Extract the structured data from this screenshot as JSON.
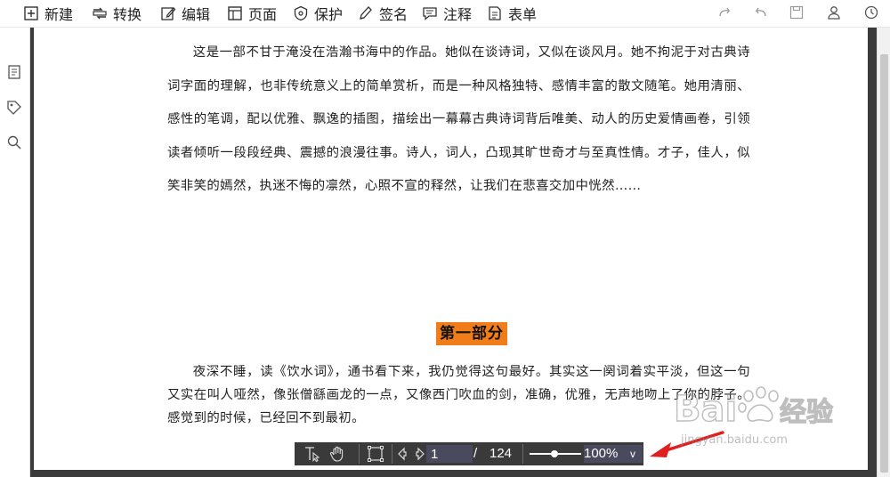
{
  "toolbar": {
    "items": [
      {
        "label": "新建",
        "icon": "new-plus-icon"
      },
      {
        "label": "转换",
        "icon": "convert-icon"
      },
      {
        "label": "编辑",
        "icon": "edit-icon"
      },
      {
        "label": "页面",
        "icon": "page-icon"
      },
      {
        "label": "保护",
        "icon": "shield-icon"
      },
      {
        "label": "签名",
        "icon": "pen-icon"
      },
      {
        "label": "注释",
        "icon": "comment-icon"
      },
      {
        "label": "表单",
        "icon": "form-icon"
      }
    ],
    "right_icons": [
      "redo-icon",
      "undo-icon",
      "save-icon",
      "user-icon",
      "refresh-icon"
    ]
  },
  "sidebar": {
    "icons": [
      "thumbnail-icon",
      "bookmark-icon",
      "search-icon"
    ]
  },
  "document": {
    "paragraph1": "这是一部不甘于淹没在浩瀚书海中的作品。她似在谈诗词，又似在谈风月。她不拘泥于对古典诗词字面的理解，也非传统意义上的简单赏析，而是一种风格独特、感情丰富的散文随笔。她用清丽、感性的笔调，配以优雅、飘逸的插图，描绘出一幕幕古典诗词背后唯美、动人的历史爱情画卷，引领读者倾听一段段经典、震撼的浪漫往事。诗人，词人，凸现其旷世奇才与至真性情。才子，佳人，似笑非笑的嫣然，执迷不悔的凛然，心照不宣的释然，让我们在悲喜交加中恍然……",
    "heading": "第一部分",
    "paragraph2": "夜深不睡，读《饮水词》，通书看下来，我仍觉得这句最好。其实这一阕词着实平淡，但这一句又实在叫人哑然，像张僧繇画龙的一点，又像西门吹血的剑，准确，优雅，无声地吻上了你的脖子。感觉到的时候，已经回不到最初。",
    "heading_color": "#f07d1a"
  },
  "navbar": {
    "current_page": "1",
    "separator": "/",
    "total_pages": "124",
    "zoom": "100%",
    "zoom_dropdown": "v",
    "zoom_slider_fraction": 0.4
  },
  "watermark": {
    "brand_main": "Baidu",
    "brand_cn": "经验",
    "url": "jingyan.baidu.com"
  },
  "colors": {
    "page_border": "#3b3b3b",
    "navbar_bg": "#3a3a3a",
    "input_bg": "#4a4a5e",
    "arrow": "#e02020"
  }
}
